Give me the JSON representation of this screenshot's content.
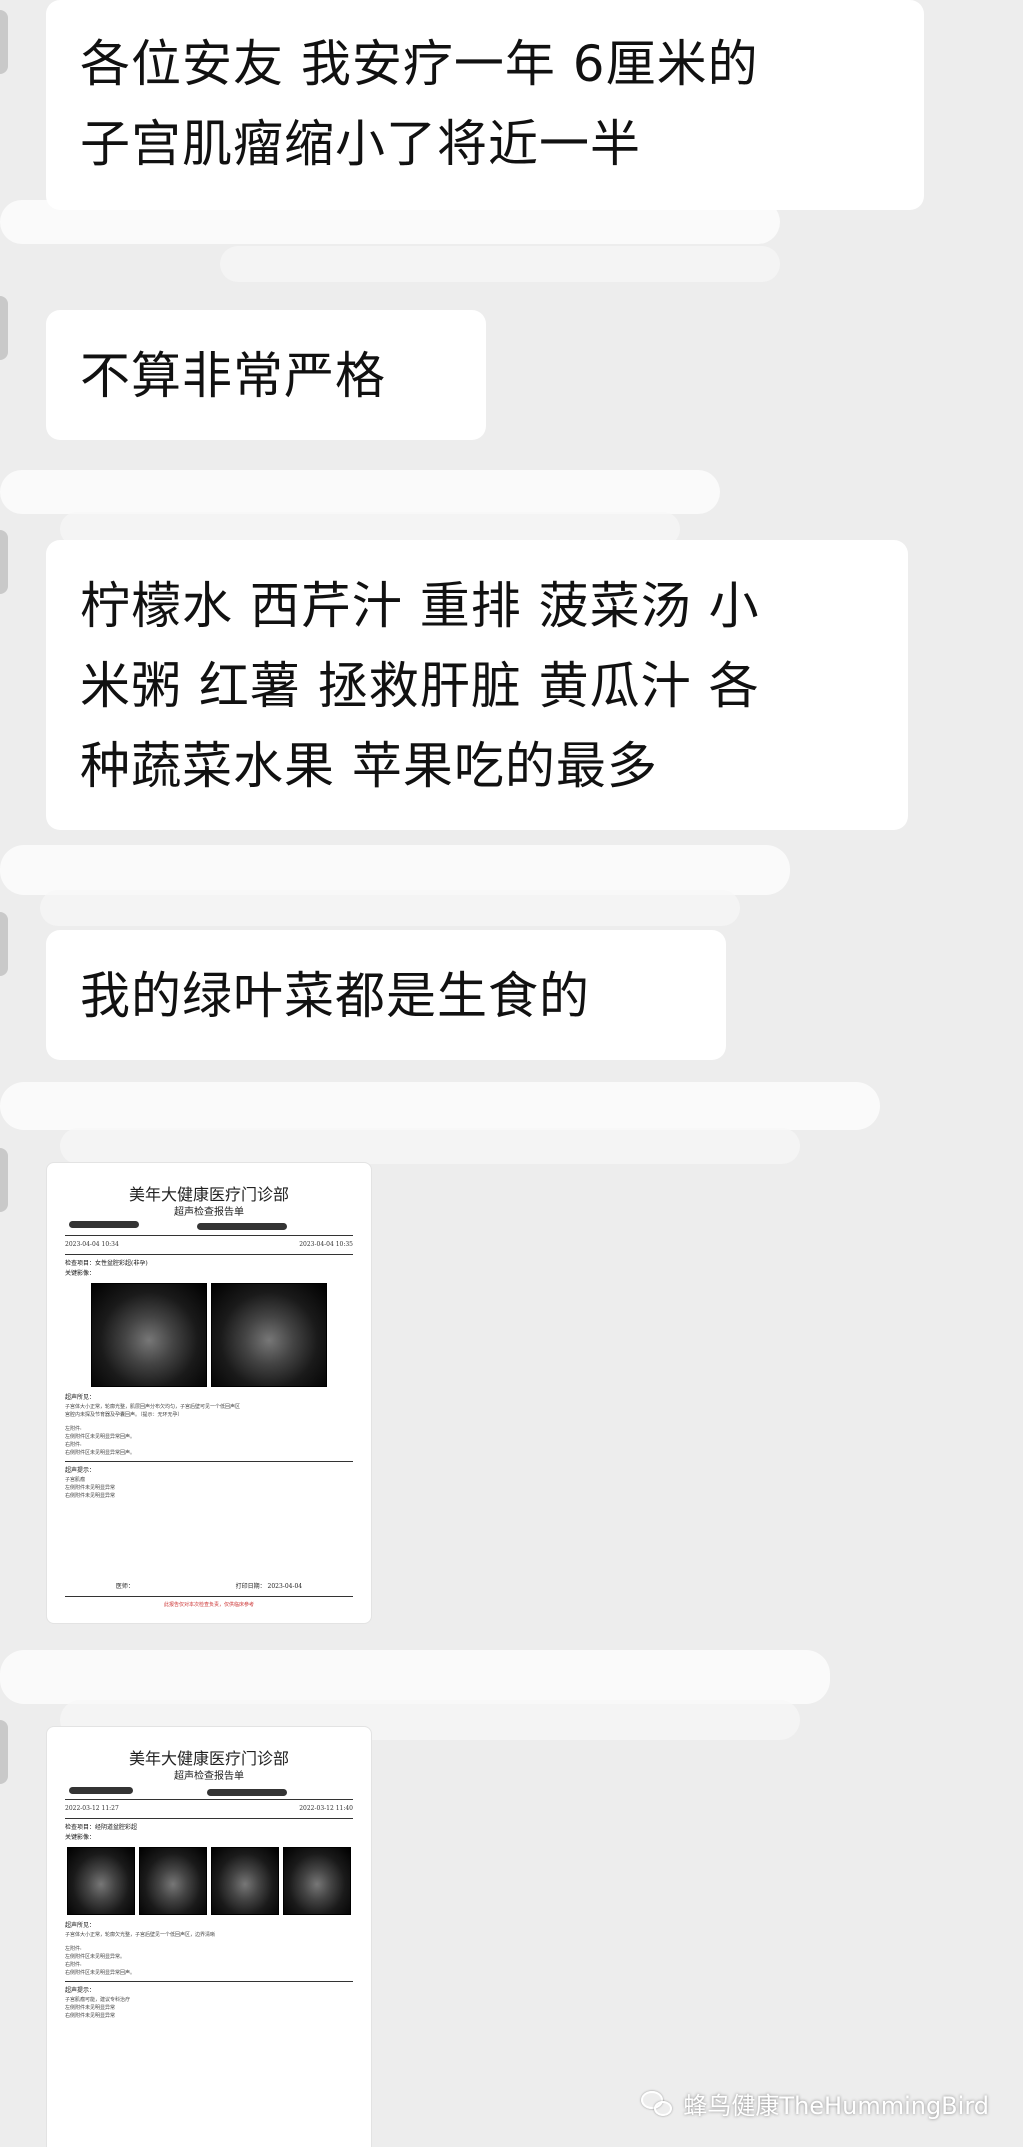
{
  "messages": [
    {
      "type": "text",
      "lines": [
        "各位安友 我安疗一年 6厘米的",
        "子宫肌瘤缩小了将近一半"
      ]
    },
    {
      "type": "text",
      "lines": [
        "不算非常严格"
      ]
    },
    {
      "type": "text",
      "lines": [
        "柠檬水 西芹汁 重排 菠菜汤 小",
        "米粥 红薯 拯救肝脏 黄瓜汁 各",
        "种蔬菜水果 苹果吃的最多"
      ]
    },
    {
      "type": "text",
      "lines": [
        "我的绿叶菜都是生食的"
      ]
    },
    {
      "type": "image",
      "report": {
        "clinic": "美年大健康医疗门诊部",
        "subtitle": "超声检查报告单",
        "exam_item": "检查项目：女性盆腔彩超(非孕)",
        "key_images": "关键影像：",
        "findings": "超声所见：",
        "conclusion": "超声提示：",
        "body_lines": [
          "子宫体大小正常，轮廓光整，肌层回声分布欠均匀，子宫后壁可见一个低回声区",
          "宫腔内未探及节育器及孕囊回声。（提示：无环无孕）",
          "左附件:",
          "左侧附件区未见明显异常回声。",
          "右附件:",
          "右侧附件区未见明显异常回声。"
        ],
        "conclusion_lines": [
          "子宫肌瘤",
          "左侧附件未见明显异常",
          "右侧附件未见明显异常"
        ],
        "doctor": "医师：",
        "print_date": "打印日期：",
        "print_date_value": "2023-04-04",
        "exam_time": "2023-04-04 10:34",
        "report_time": "2023-04-04 10:35",
        "footer": "此报告仅对本次检查负责，仅供临床参考"
      }
    },
    {
      "type": "image",
      "report": {
        "clinic": "美年大健康医疗门诊部",
        "subtitle": "超声检查报告单",
        "exam_item": "检查项目：经阴道盆腔彩超",
        "key_images": "关键影像：",
        "findings": "超声所见：",
        "conclusion": "超声提示：",
        "body_lines": [
          "子宫体大小正常，轮廓欠光整，子宫后壁见一个低回声区，边界清晰",
          "左附件:",
          "左侧附件区未见明显异常。",
          "右附件:",
          "右侧附件区未见明显异常回声。"
        ],
        "conclusion_lines": [
          "子宫肌瘤可能，建议专科治疗",
          "左侧附件未见明显异常",
          "右侧附件未见明显异常"
        ],
        "exam_time": "2022-03-12 11:27",
        "report_time": "2022-03-12 11:40"
      }
    }
  ],
  "watermark": {
    "text": "蜂鸟健康TheHummingBird",
    "icon": "wechat-icon"
  },
  "colors": {
    "background": "#ededed",
    "bubble": "#ffffff",
    "text": "#111111"
  }
}
